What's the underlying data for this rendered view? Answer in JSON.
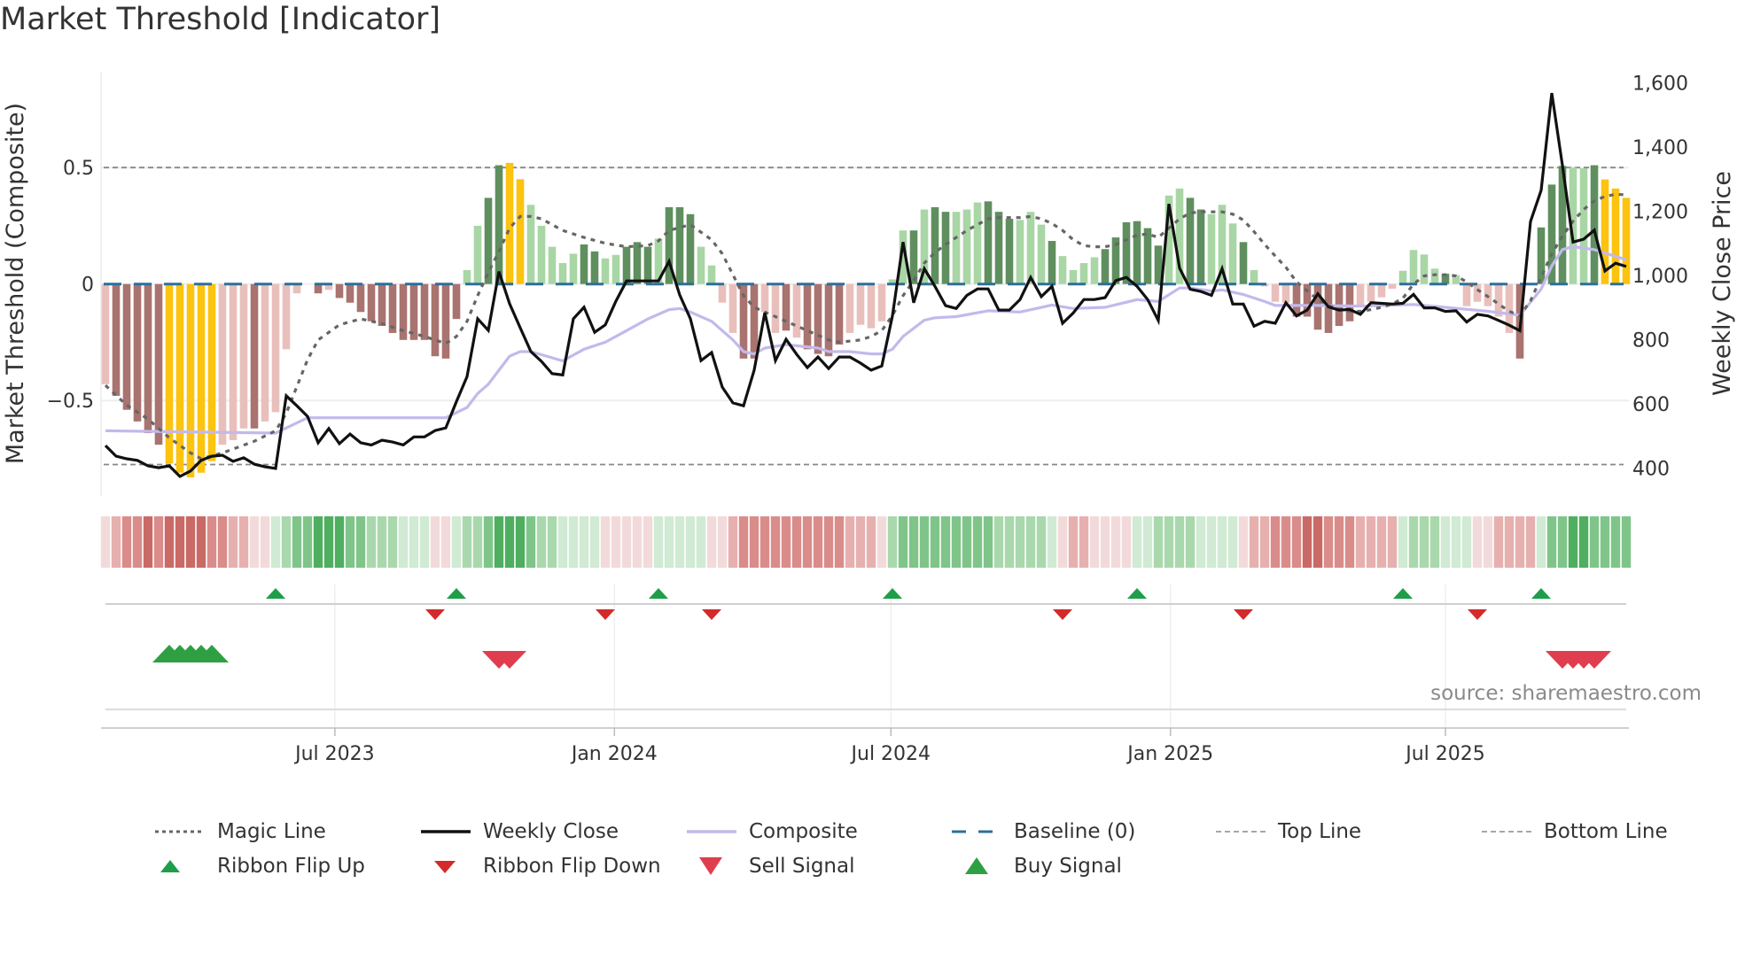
{
  "title": "Market Threshold [Indicator]",
  "source": "source: sharemaestro.com",
  "colors": {
    "bar_dark_red": "#a9736f",
    "bar_light_red": "#e9bfbc",
    "bar_yellow": "#fcc30f",
    "bar_dark_green": "#5f8f5f",
    "bar_light_green": "#a9d6a5",
    "weekly_close": "#111111",
    "composite": "#c3b9ec",
    "magic_line": "#666666",
    "baseline": "#2e6f99",
    "top_bottom": "#888888",
    "flip_up": "#1f9e4a",
    "flip_down": "#d42a2a",
    "sell": "#e03e4e",
    "buy": "#2ea043",
    "ribbon_red": [
      "#f3dada",
      "#e6b0af",
      "#d98c8a",
      "#c96a66"
    ],
    "ribbon_green": [
      "#d0eAd3",
      "#a9d8ad",
      "#7fc589",
      "#4fae60"
    ]
  },
  "legend": [
    {
      "label": "Magic Line",
      "icon": "dotted-line"
    },
    {
      "label": "Weekly Close",
      "icon": "solid-black-line"
    },
    {
      "label": "Composite",
      "icon": "lavender-line"
    },
    {
      "label": "Baseline (0)",
      "icon": "dashed-blue-line"
    },
    {
      "label": "Top Line",
      "icon": "dashed-gray-line"
    },
    {
      "label": "Bottom Line",
      "icon": "dashed-gray-line"
    },
    {
      "label": "Ribbon Flip Up",
      "icon": "small-green-triangle-up"
    },
    {
      "label": "Ribbon Flip Down",
      "icon": "small-red-triangle-down"
    },
    {
      "label": "Sell Signal",
      "icon": "red-triangle-down"
    },
    {
      "label": "Buy Signal",
      "icon": "green-triangle-up"
    }
  ],
  "chart_data": {
    "type": "bar+line",
    "title": "Market Threshold [Indicator]",
    "x_start": "2023-01-31",
    "x_step_days": 7,
    "weeks": 144,
    "xticks": [
      {
        "label": "Jul 2023",
        "date": "2023-07-01"
      },
      {
        "label": "Jan 2024",
        "date": "2024-01-01"
      },
      {
        "label": "Jul 2024",
        "date": "2024-07-01"
      },
      {
        "label": "Jan 2025",
        "date": "2025-01-01"
      },
      {
        "label": "Jul 2025",
        "date": "2025-07-01"
      }
    ],
    "left_axis": {
      "label": "Market Threshold (Composite)",
      "ticks": [
        {
          "v": 0.5,
          "label": "0.5"
        },
        {
          "v": 0,
          "label": "0"
        },
        {
          "v": -0.5,
          "label": "−0.5"
        }
      ],
      "grid": true
    },
    "right_axis": {
      "label": "Weekly Close Price",
      "ticks": [
        {
          "v": 400,
          "label": "400"
        },
        {
          "v": 600,
          "label": "600"
        },
        {
          "v": 800,
          "label": "800"
        },
        {
          "v": 1000,
          "label": "1,000"
        },
        {
          "v": 1200,
          "label": "1,200"
        },
        {
          "v": 1400,
          "label": "1,400"
        },
        {
          "v": 1600,
          "label": "1,600"
        }
      ]
    },
    "top_line": 0.5,
    "bottom_line": -0.775,
    "baseline": 0,
    "composite_bars": [
      -0.43,
      -0.48,
      -0.54,
      -0.59,
      -0.64,
      -0.69,
      -0.77,
      -0.81,
      -0.83,
      -0.81,
      -0.76,
      -0.69,
      -0.67,
      -0.62,
      -0.62,
      -0.59,
      -0.55,
      -0.28,
      -0.04,
      0,
      -0.04,
      -0.025,
      -0.06,
      -0.08,
      -0.12,
      -0.16,
      -0.18,
      -0.21,
      -0.24,
      -0.24,
      -0.24,
      -0.31,
      -0.32,
      -0.15,
      0.06,
      0.25,
      0.37,
      0.51,
      0.52,
      0.45,
      0.34,
      0.25,
      0.16,
      0.09,
      0.13,
      0.17,
      0.14,
      0.11,
      0.125,
      0.16,
      0.18,
      0.16,
      0.195,
      0.33,
      0.33,
      0.3,
      0.16,
      0.08,
      -0.08,
      -0.21,
      -0.32,
      -0.32,
      -0.12,
      -0.21,
      -0.2,
      -0.23,
      -0.28,
      -0.3,
      -0.31,
      -0.26,
      -0.21,
      -0.175,
      -0.19,
      -0.16,
      0.02,
      0.23,
      0.23,
      0.32,
      0.33,
      0.31,
      0.31,
      0.32,
      0.35,
      0.355,
      0.31,
      0.28,
      0.275,
      0.31,
      0.255,
      0.185,
      0.12,
      0.06,
      0.09,
      0.115,
      0.15,
      0.2,
      0.265,
      0.27,
      0.24,
      0.165,
      0.38,
      0.41,
      0.37,
      0.32,
      0.3,
      0.34,
      0.26,
      0.18,
      0.06,
      -0.01,
      -0.076,
      -0.08,
      -0.14,
      -0.14,
      -0.196,
      -0.21,
      -0.18,
      -0.16,
      -0.1,
      -0.076,
      -0.057,
      -0.02,
      0.057,
      0.146,
      0.127,
      0.066,
      0.044,
      0.038,
      -0.095,
      -0.076,
      -0.095,
      -0.14,
      -0.21,
      -0.32,
      0,
      0.243,
      0.427,
      0.507,
      0.5,
      0.497,
      0.51,
      0.449,
      0.41,
      0.37
    ],
    "bar_shades": "ldddddyyyyyllldllllldlddddddddddddllddyylllllddlldddldddllllddlldlddddlllllldlddllldddllldllllddddddllddllldllllddddddlllllllldlllllldddddlldyyyylll",
    "weekly_close": [
      470,
      437,
      429,
      424,
      407,
      401,
      407,
      374,
      391,
      424,
      437,
      440,
      421,
      432,
      412,
      404,
      399,
      625,
      594,
      561,
      479,
      523,
      476,
      506,
      479,
      472,
      487,
      481,
      472,
      497,
      497,
      517,
      525,
      607,
      685,
      865,
      829,
      1012,
      912,
      837,
      763,
      732,
      694,
      690,
      865,
      901,
      823,
      846,
      920,
      983,
      983,
      983,
      983,
      1044,
      939,
      865,
      735,
      760,
      652,
      603,
      594,
      705,
      884,
      735,
      801,
      754,
      713,
      746,
      710,
      746,
      746,
      727,
      705,
      718,
      874,
      1104,
      915,
      1021,
      966,
      906,
      897,
      938,
      958,
      958,
      892,
      892,
      925,
      994,
      934,
      966,
      851,
      883,
      925,
      925,
      931,
      984,
      994,
      966,
      925,
      860,
      1223,
      1023,
      957,
      950,
      938,
      1021,
      911,
      911,
      842,
      857,
      851,
      915,
      874,
      892,
      943,
      902,
      892,
      894,
      879,
      915,
      913,
      911,
      913,
      941,
      899,
      899,
      888,
      890,
      855,
      879,
      874,
      860,
      845,
      828,
      1168,
      1265,
      1568,
      1343,
      1104,
      1113,
      1141,
      1014,
      1038,
      1028
    ],
    "magic_line": [
      [
        1,
        -0.435
      ],
      [
        3,
        -0.52
      ],
      [
        5,
        -0.58
      ],
      [
        7,
        -0.66
      ],
      [
        9,
        -0.725
      ],
      [
        10,
        -0.75
      ],
      [
        12,
        -0.725
      ],
      [
        15,
        -0.675
      ],
      [
        17,
        -0.63
      ],
      [
        18,
        -0.555
      ],
      [
        19,
        -0.44
      ],
      [
        20,
        -0.325
      ],
      [
        21,
        -0.24
      ],
      [
        23,
        -0.175
      ],
      [
        25,
        -0.15
      ],
      [
        27,
        -0.17
      ],
      [
        29,
        -0.2
      ],
      [
        31,
        -0.225
      ],
      [
        33,
        -0.255
      ],
      [
        34,
        -0.225
      ],
      [
        35,
        -0.16
      ],
      [
        36,
        -0.05
      ],
      [
        37,
        0.05
      ],
      [
        38,
        0.14
      ],
      [
        39,
        0.24
      ],
      [
        40,
        0.29
      ],
      [
        41,
        0.29
      ],
      [
        42,
        0.28
      ],
      [
        44,
        0.23
      ],
      [
        46,
        0.2
      ],
      [
        48,
        0.175
      ],
      [
        50,
        0.16
      ],
      [
        52,
        0.165
      ],
      [
        53,
        0.185
      ],
      [
        54,
        0.23
      ],
      [
        56,
        0.255
      ],
      [
        58,
        0.19
      ],
      [
        59,
        0.13
      ],
      [
        60,
        0.04
      ],
      [
        61,
        -0.05
      ],
      [
        62,
        -0.1
      ],
      [
        63,
        -0.12
      ],
      [
        65,
        -0.16
      ],
      [
        67,
        -0.2
      ],
      [
        69,
        -0.24
      ],
      [
        70,
        -0.25
      ],
      [
        72,
        -0.24
      ],
      [
        73,
        -0.225
      ],
      [
        74,
        -0.2
      ],
      [
        75,
        -0.135
      ],
      [
        76,
        -0.05
      ],
      [
        77,
        0.015
      ],
      [
        78,
        0.09
      ],
      [
        79,
        0.135
      ],
      [
        80,
        0.17
      ],
      [
        81,
        0.2
      ],
      [
        82,
        0.23
      ],
      [
        83,
        0.255
      ],
      [
        84,
        0.28
      ],
      [
        85,
        0.285
      ],
      [
        87,
        0.285
      ],
      [
        88,
        0.29
      ],
      [
        89,
        0.28
      ],
      [
        90,
        0.26
      ],
      [
        91,
        0.23
      ],
      [
        92,
        0.19
      ],
      [
        93,
        0.165
      ],
      [
        94,
        0.16
      ],
      [
        95,
        0.16
      ],
      [
        96,
        0.17
      ],
      [
        97,
        0.19
      ],
      [
        98,
        0.21
      ],
      [
        99,
        0.215
      ],
      [
        100,
        0.2
      ],
      [
        101,
        0.24
      ],
      [
        102,
        0.28
      ],
      [
        103,
        0.305
      ],
      [
        104,
        0.31
      ],
      [
        106,
        0.31
      ],
      [
        107,
        0.3
      ],
      [
        108,
        0.275
      ],
      [
        109,
        0.225
      ],
      [
        110,
        0.17
      ],
      [
        111,
        0.12
      ],
      [
        112,
        0.072
      ],
      [
        113,
        0.009
      ],
      [
        114,
        -0.029
      ],
      [
        115,
        -0.067
      ],
      [
        116,
        -0.092
      ],
      [
        117,
        -0.108
      ],
      [
        118,
        -0.117
      ],
      [
        119,
        -0.117
      ],
      [
        120,
        -0.11
      ],
      [
        121,
        -0.1
      ],
      [
        122,
        -0.086
      ],
      [
        123,
        -0.061
      ],
      [
        124,
        0.0
      ],
      [
        125,
        0.035
      ],
      [
        126,
        0.04
      ],
      [
        127,
        0.04
      ],
      [
        128,
        0.035
      ],
      [
        129,
        0.009
      ],
      [
        130,
        -0.024
      ],
      [
        131,
        -0.054
      ],
      [
        132,
        -0.086
      ],
      [
        133,
        -0.117
      ],
      [
        134,
        -0.136
      ],
      [
        135,
        -0.072
      ],
      [
        136,
        0.029
      ],
      [
        137,
        0.13
      ],
      [
        138,
        0.205
      ],
      [
        139,
        0.27
      ],
      [
        140,
        0.32
      ],
      [
        141,
        0.357
      ],
      [
        142,
        0.376
      ],
      [
        143,
        0.385
      ],
      [
        144,
        0.383
      ]
    ],
    "composite_line": [
      [
        1,
        -0.63
      ],
      [
        17,
        -0.64
      ],
      [
        20,
        -0.574
      ],
      [
        33,
        -0.574
      ],
      [
        35,
        -0.53
      ],
      [
        36,
        -0.47
      ],
      [
        37,
        -0.43
      ],
      [
        38,
        -0.37
      ],
      [
        39,
        -0.31
      ],
      [
        40,
        -0.29
      ],
      [
        41,
        -0.29
      ],
      [
        44,
        -0.33
      ],
      [
        46,
        -0.28
      ],
      [
        48,
        -0.25
      ],
      [
        50,
        -0.2
      ],
      [
        52,
        -0.15
      ],
      [
        54,
        -0.11
      ],
      [
        55,
        -0.105
      ],
      [
        56,
        -0.12
      ],
      [
        58,
        -0.16
      ],
      [
        60,
        -0.24
      ],
      [
        61,
        -0.29
      ],
      [
        62,
        -0.3
      ],
      [
        63,
        -0.275
      ],
      [
        65,
        -0.26
      ],
      [
        66,
        -0.265
      ],
      [
        68,
        -0.275
      ],
      [
        69,
        -0.29
      ],
      [
        71,
        -0.29
      ],
      [
        73,
        -0.3
      ],
      [
        74,
        -0.3
      ],
      [
        75,
        -0.28
      ],
      [
        76,
        -0.225
      ],
      [
        78,
        -0.155
      ],
      [
        79,
        -0.145
      ],
      [
        81,
        -0.14
      ],
      [
        84,
        -0.115
      ],
      [
        87,
        -0.12
      ],
      [
        90,
        -0.09
      ],
      [
        92,
        -0.105
      ],
      [
        95,
        -0.1
      ],
      [
        98,
        -0.067
      ],
      [
        100,
        -0.075
      ],
      [
        102,
        -0.017
      ],
      [
        103,
        -0.017
      ],
      [
        105,
        -0.03
      ],
      [
        106,
        -0.025
      ],
      [
        108,
        -0.045
      ],
      [
        110,
        -0.075
      ],
      [
        111,
        -0.092
      ],
      [
        115,
        -0.092
      ],
      [
        119,
        -0.095
      ],
      [
        124,
        -0.088
      ],
      [
        127,
        -0.1
      ],
      [
        131,
        -0.117
      ],
      [
        134,
        -0.134
      ],
      [
        136,
        -0.022
      ],
      [
        137,
        0.078
      ],
      [
        138,
        0.148
      ],
      [
        139,
        0.161
      ],
      [
        141,
        0.148
      ],
      [
        144,
        0.104
      ]
    ],
    "ribbon_levels": [
      -1,
      -2,
      -3,
      -3,
      -4,
      -3,
      -4,
      -4,
      -4,
      -4,
      -3,
      -3,
      -2,
      -2,
      -1,
      -1,
      1,
      2,
      3,
      3,
      4,
      4,
      4,
      3,
      3,
      2,
      2,
      2,
      1,
      1,
      1,
      -1,
      -1,
      1,
      2,
      2,
      3,
      4,
      4,
      4,
      3,
      2,
      2,
      1,
      1,
      1,
      1,
      -1,
      -1,
      -1,
      -1,
      -1,
      1,
      1,
      1,
      1,
      1,
      -1,
      -1,
      -2,
      -3,
      -3,
      -3,
      -3,
      -3,
      -3,
      -3,
      -3,
      -3,
      -3,
      -2,
      -2,
      -2,
      -1,
      2,
      3,
      3,
      3,
      3,
      3,
      3,
      3,
      3,
      3,
      2,
      2,
      2,
      2,
      2,
      1,
      -1,
      -2,
      -2,
      -1,
      -1,
      -1,
      -1,
      1,
      1,
      2,
      2,
      2,
      2,
      1,
      1,
      1,
      1,
      -1,
      -2,
      -2,
      -3,
      -3,
      -3,
      -4,
      -4,
      -3,
      -3,
      -3,
      -2,
      -2,
      -2,
      -2,
      1,
      2,
      2,
      2,
      1,
      1,
      1,
      -1,
      -1,
      -2,
      -2,
      -2,
      -2,
      1,
      3,
      3,
      4,
      4,
      3,
      3,
      3,
      3
    ],
    "ribbon_flip_up_weeks": [
      17,
      34,
      53,
      75,
      98,
      123,
      136
    ],
    "ribbon_flip_down_weeks": [
      32,
      48,
      58,
      91,
      108,
      130
    ],
    "buy_signal_weeks": [
      7,
      8,
      9,
      10,
      11
    ],
    "sell_signal_weeks": [
      38,
      39,
      138,
      139,
      140,
      141
    ]
  }
}
